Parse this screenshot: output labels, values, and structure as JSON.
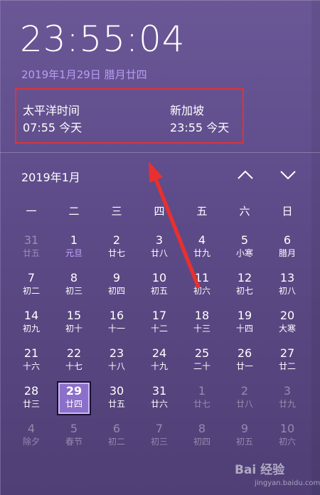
{
  "clock": {
    "time": "23:55:04",
    "date": "2019年1月29日 腊月廿四"
  },
  "timezones": [
    {
      "name": "太平洋时间",
      "time": "07:55 今天"
    },
    {
      "name": "新加坡",
      "time": "23:55 今天"
    }
  ],
  "calendar": {
    "month": "2019年1月",
    "weekdays": [
      "一",
      "二",
      "三",
      "四",
      "五",
      "六",
      "日"
    ],
    "days": [
      {
        "n": "31",
        "l": "廿五",
        "dim": true
      },
      {
        "n": "1",
        "l": "元旦",
        "fest": true
      },
      {
        "n": "2",
        "l": "廿七"
      },
      {
        "n": "3",
        "l": "廿八"
      },
      {
        "n": "4",
        "l": "廿九"
      },
      {
        "n": "5",
        "l": "小寒"
      },
      {
        "n": "6",
        "l": "腊月"
      },
      {
        "n": "7",
        "l": "初二"
      },
      {
        "n": "8",
        "l": "初三"
      },
      {
        "n": "9",
        "l": "初四"
      },
      {
        "n": "10",
        "l": "初五"
      },
      {
        "n": "11",
        "l": "初六"
      },
      {
        "n": "12",
        "l": "初七"
      },
      {
        "n": "13",
        "l": "初八"
      },
      {
        "n": "14",
        "l": "初九"
      },
      {
        "n": "15",
        "l": "初十"
      },
      {
        "n": "16",
        "l": "十一"
      },
      {
        "n": "17",
        "l": "十二"
      },
      {
        "n": "18",
        "l": "十三"
      },
      {
        "n": "19",
        "l": "十四"
      },
      {
        "n": "20",
        "l": "大寒"
      },
      {
        "n": "21",
        "l": "十六"
      },
      {
        "n": "22",
        "l": "十七"
      },
      {
        "n": "23",
        "l": "十八"
      },
      {
        "n": "24",
        "l": "十九"
      },
      {
        "n": "25",
        "l": "二十"
      },
      {
        "n": "26",
        "l": "廿一"
      },
      {
        "n": "27",
        "l": "廿二"
      },
      {
        "n": "28",
        "l": "廿三"
      },
      {
        "n": "29",
        "l": "廿四",
        "today": true
      },
      {
        "n": "30",
        "l": "廿五"
      },
      {
        "n": "31",
        "l": "廿六"
      },
      {
        "n": "1",
        "l": "廿七",
        "dim": true
      },
      {
        "n": "2",
        "l": "廿八",
        "dim": true
      },
      {
        "n": "3",
        "l": "廿九",
        "dim": true
      },
      {
        "n": "4",
        "l": "除夕",
        "dim": true
      },
      {
        "n": "5",
        "l": "春节",
        "dim": true
      },
      {
        "n": "6",
        "l": "初二",
        "dim": true
      },
      {
        "n": "7",
        "l": "初三",
        "dim": true
      },
      {
        "n": "8",
        "l": "初四",
        "dim": true
      },
      {
        "n": "9",
        "l": "初五",
        "dim": true
      },
      {
        "n": "10",
        "l": "初六",
        "dim": true
      }
    ]
  },
  "watermark": {
    "text": "Bai 经验",
    "url": "jingyan.baidu.com"
  },
  "colors": {
    "highlight_border": "#e23232",
    "date_accent": "#b99cf0",
    "today_fill": "#8b6fc9"
  }
}
